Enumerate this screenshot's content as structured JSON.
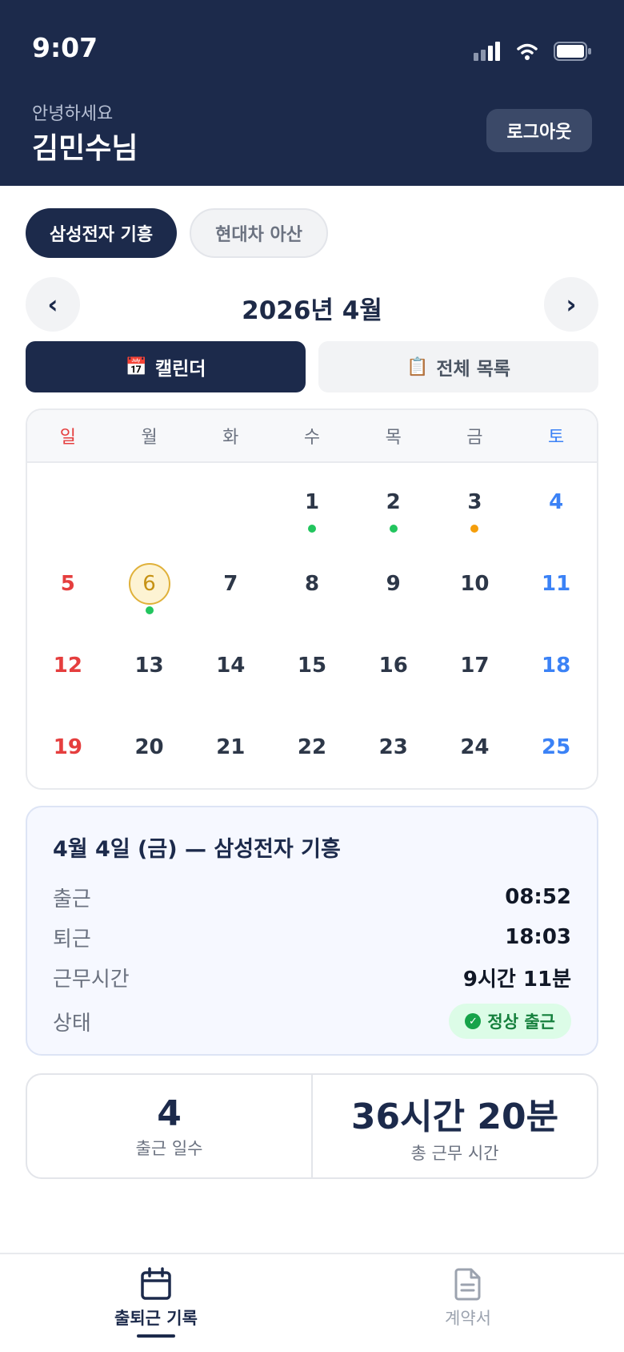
{
  "status_bar": {
    "time": "9:07"
  },
  "header": {
    "greeting": "안녕하세요",
    "user_name": "김민수님",
    "logout_label": "로그아웃"
  },
  "workplace_tabs": [
    {
      "label": "삼성전자 기흥",
      "active": true
    },
    {
      "label": "현대차 아산",
      "active": false
    }
  ],
  "month_nav": {
    "title": "2026년 4월",
    "prev_glyph": "‹",
    "next_glyph": "›"
  },
  "view_toggle": {
    "calendar_icon": "📅",
    "calendar_label": "캘린더",
    "list_icon": "📋",
    "list_label": "전체 목록"
  },
  "calendar": {
    "weekdays": [
      "일",
      "월",
      "화",
      "수",
      "목",
      "금",
      "토"
    ],
    "days": [
      {
        "day": "",
        "dot": null
      },
      {
        "day": "",
        "dot": null
      },
      {
        "day": "",
        "dot": null
      },
      {
        "day": "1",
        "dot": "green"
      },
      {
        "day": "2",
        "dot": "green"
      },
      {
        "day": "3",
        "dot": "orange"
      },
      {
        "day": "4",
        "dot": null
      },
      {
        "day": "5",
        "dot": null
      },
      {
        "day": "6",
        "dot": "green",
        "today": true
      },
      {
        "day": "7",
        "dot": null
      },
      {
        "day": "8",
        "dot": null
      },
      {
        "day": "9",
        "dot": null
      },
      {
        "day": "10",
        "dot": null
      },
      {
        "day": "11",
        "dot": null
      },
      {
        "day": "12",
        "dot": null
      },
      {
        "day": "13",
        "dot": null
      },
      {
        "day": "14",
        "dot": null
      },
      {
        "day": "15",
        "dot": null
      },
      {
        "day": "16",
        "dot": null
      },
      {
        "day": "17",
        "dot": null
      },
      {
        "day": "18",
        "dot": null
      },
      {
        "day": "19",
        "dot": null
      },
      {
        "day": "20",
        "dot": null
      },
      {
        "day": "21",
        "dot": null
      },
      {
        "day": "22",
        "dot": null
      },
      {
        "day": "23",
        "dot": null
      },
      {
        "day": "24",
        "dot": null
      },
      {
        "day": "25",
        "dot": null
      }
    ],
    "dot_colors": {
      "green": "#22c55e",
      "orange": "#f59e0b"
    }
  },
  "detail": {
    "title": "4월 4일 (금) — 삼성전자 기흥",
    "checkin_label": "출근",
    "checkin_value": "08:52",
    "checkout_label": "퇴근",
    "checkout_value": "18:03",
    "worktime_label": "근무시간",
    "worktime_value": "9시간 11분",
    "status_label": "상태",
    "status_value": "정상 출근"
  },
  "stats": {
    "days_value": "4",
    "days_label": "출근 일수",
    "total_value": "36시간 20분",
    "total_label": "총 근무 시간"
  },
  "tabbar": {
    "attendance_label": "출퇴근 기록",
    "attendance_icon": "calendar-icon",
    "contract_label": "계약서",
    "contract_icon": "document-icon"
  }
}
